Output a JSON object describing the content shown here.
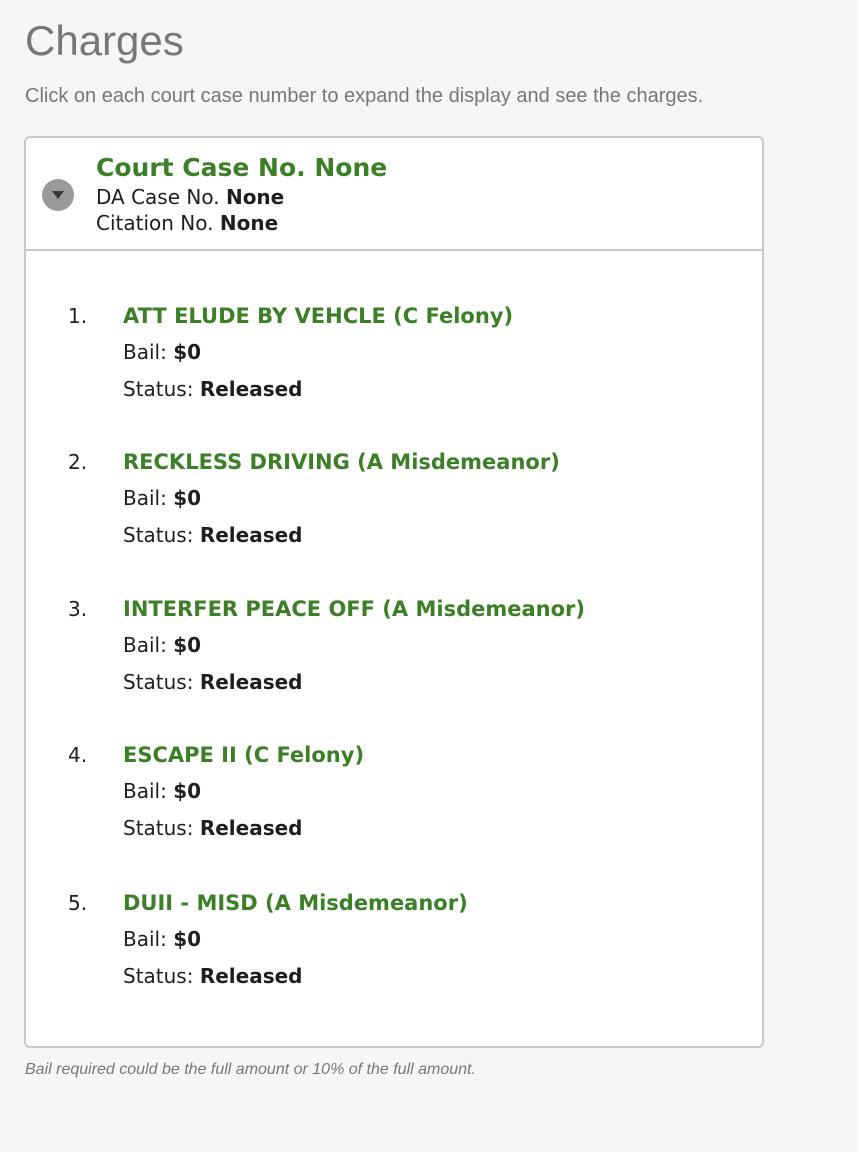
{
  "page": {
    "title": "Charges",
    "intro": "Click on each court case number to expand the display and see the charges.",
    "footnote": "Bail required could be the full amount or 10% of the full amount."
  },
  "case": {
    "court_case_label": "Court Case No. None",
    "da_case_label": "DA Case No.",
    "da_case_value": "None",
    "citation_label": "Citation No.",
    "citation_value": "None",
    "toggle_icon": "chevron-down-icon"
  },
  "labels": {
    "bail": "Bail:",
    "status": "Status:"
  },
  "charges": [
    {
      "number": "1.",
      "name": "ATT ELUDE BY VEHCLE (C Felony)",
      "bail": "$0",
      "status": "Released"
    },
    {
      "number": "2.",
      "name": "RECKLESS DRIVING (A Misdemeanor)",
      "bail": "$0",
      "status": "Released"
    },
    {
      "number": "3.",
      "name": "INTERFER PEACE OFF (A Misdemeanor)",
      "bail": "$0",
      "status": "Released"
    },
    {
      "number": "4.",
      "name": "ESCAPE II (C Felony)",
      "bail": "$0",
      "status": "Released"
    },
    {
      "number": "5.",
      "name": "DUII - MISD (A Misdemeanor)",
      "bail": "$0",
      "status": "Released"
    }
  ],
  "colors": {
    "accent_green": "#3b7f26",
    "muted_gray": "#777777"
  }
}
